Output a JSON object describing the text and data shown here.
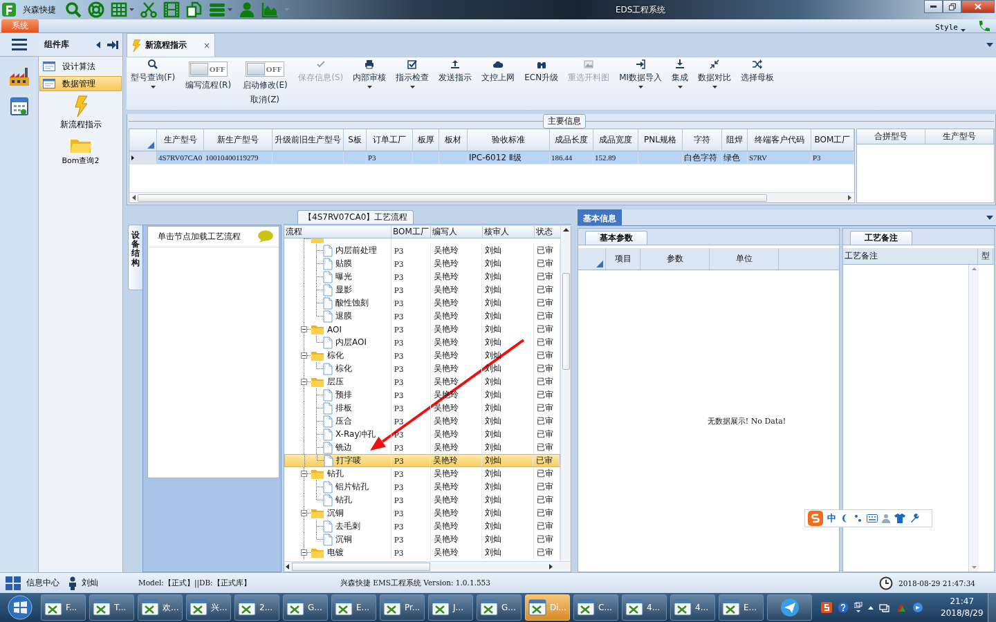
{
  "window": {
    "app_name": "兴森快捷",
    "title": "EDS工程系统"
  },
  "ribbon": {
    "tabs": [
      {
        "label": "系统",
        "selected": true
      }
    ],
    "style_menu": "Style"
  },
  "sidebar": {
    "title": "组件库",
    "items": [
      {
        "label": "设计算法",
        "selected": false
      },
      {
        "label": "数据管理",
        "selected": true
      }
    ],
    "tools": [
      {
        "label": "新流程指示"
      },
      {
        "label": "Bom查询2"
      }
    ]
  },
  "document_tabs": [
    {
      "label": "新流程指示",
      "selected": true,
      "close_glyph": "×"
    }
  ],
  "toolbar": [
    {
      "kind": "button",
      "label": "型号查询(F)",
      "disabled": false,
      "dropdown": true
    },
    {
      "kind": "toggle",
      "label": "编写流程(R)",
      "on": false,
      "state_text": "OFF"
    },
    {
      "kind": "toggle",
      "label": "启动修改(E)",
      "sublabel": "取消(Z)",
      "on": false,
      "state_text": "OFF"
    },
    {
      "kind": "button",
      "label": "保存信息(S)",
      "disabled": true,
      "dropdown": false
    },
    {
      "kind": "button",
      "label": "内部审核",
      "disabled": false,
      "dropdown": true
    },
    {
      "kind": "button",
      "label": "指示检查",
      "disabled": false,
      "dropdown": true
    },
    {
      "kind": "button",
      "label": "发送指示",
      "disabled": false,
      "dropdown": false
    },
    {
      "kind": "button",
      "label": "文控上网",
      "disabled": false,
      "dropdown": false
    },
    {
      "kind": "button",
      "label": "ECN升级",
      "disabled": false,
      "dropdown": false
    },
    {
      "kind": "button",
      "label": "重选开料图",
      "disabled": true,
      "dropdown": false
    },
    {
      "kind": "button",
      "label": "MI数据导入",
      "disabled": false,
      "dropdown": true
    },
    {
      "kind": "button",
      "label": "集成",
      "disabled": false,
      "dropdown": true
    },
    {
      "kind": "button",
      "label": "数据对比",
      "disabled": false,
      "dropdown": true
    },
    {
      "kind": "button",
      "label": "选择母板",
      "disabled": false,
      "dropdown": false
    }
  ],
  "main_info": {
    "title": "主要信息",
    "columns": [
      "生产型号",
      "新生产型号",
      "升级前旧生产型号",
      "S板",
      "订单工厂",
      "板厚",
      "板材",
      "验收标准",
      "成品长度",
      "成品宽度",
      "PNL规格",
      "字符",
      "阻焊",
      "终端客户代码",
      "BOM工厂"
    ],
    "rows": [
      {
        "selected": true,
        "cells": [
          "4S7RV07CA0",
          "10010400119279",
          null,
          null,
          "P3",
          null,
          null,
          "IPC-6012 Ⅱ级",
          "186.44",
          "152.89",
          null,
          "白色字符",
          "绿色",
          "S7RV",
          "P3"
        ]
      }
    ],
    "side_columns": [
      "合拼型号",
      "生产型号"
    ]
  },
  "process": {
    "side_tab": "设备结构",
    "hint": "单击节点加载工艺流程",
    "title": "【4S7RV07CA0】工艺流程",
    "columns": [
      "流程",
      "BOM工厂",
      "编写人",
      "核审人",
      "状态"
    ],
    "tree": [
      {
        "kind": "folder",
        "selected": false,
        "children": [
          {
            "kind": "file",
            "label": "内层前处理",
            "bom": "P3",
            "author": "吴艳玲",
            "reviewer": "刘灿",
            "status": "已审",
            "selected": false
          },
          {
            "kind": "file",
            "label": "贴膜",
            "bom": "P3",
            "author": "吴艳玲",
            "reviewer": "刘灿",
            "status": "已审",
            "selected": false
          },
          {
            "kind": "file",
            "label": "曝光",
            "bom": "P3",
            "author": "吴艳玲",
            "reviewer": "刘灿",
            "status": "已审",
            "selected": false
          },
          {
            "kind": "file",
            "label": "显影",
            "bom": "P3",
            "author": "吴艳玲",
            "reviewer": "刘灿",
            "status": "已审",
            "selected": false
          },
          {
            "kind": "file",
            "label": "酸性蚀刻",
            "bom": "P3",
            "author": "吴艳玲",
            "reviewer": "刘灿",
            "status": "已审",
            "selected": false
          },
          {
            "kind": "file",
            "label": "退膜",
            "bom": "P3",
            "author": "吴艳玲",
            "reviewer": "刘灿",
            "status": "已审",
            "selected": false
          }
        ]
      },
      {
        "kind": "folder",
        "label": "AOI",
        "bom": "P3",
        "author": "吴艳玲",
        "reviewer": "刘灿",
        "status": "已审",
        "expanded": true,
        "selected": false,
        "children": [
          {
            "kind": "file",
            "label": "内层AOI",
            "bom": "P3",
            "author": "吴艳玲",
            "reviewer": "刘灿",
            "status": "已审",
            "selected": false
          }
        ]
      },
      {
        "kind": "folder",
        "label": "棕化",
        "bom": "P3",
        "author": "吴艳玲",
        "reviewer": "刘灿",
        "status": "已审",
        "expanded": true,
        "selected": false,
        "children": [
          {
            "kind": "file",
            "label": "棕化",
            "bom": "P3",
            "author": "吴艳玲",
            "reviewer": "刘灿",
            "status": "已审",
            "selected": false
          }
        ]
      },
      {
        "kind": "folder",
        "label": "层压",
        "bom": "P3",
        "author": "吴艳玲",
        "reviewer": "刘灿",
        "status": "已审",
        "expanded": true,
        "selected": false,
        "children": [
          {
            "kind": "file",
            "label": "预排",
            "bom": "P3",
            "author": "吴艳玲",
            "reviewer": "刘灿",
            "status": "已审",
            "selected": false
          },
          {
            "kind": "file",
            "label": "排板",
            "bom": "P3",
            "author": "吴艳玲",
            "reviewer": "刘灿",
            "status": "已审",
            "selected": false
          },
          {
            "kind": "file",
            "label": "压合",
            "bom": "P3",
            "author": "吴艳玲",
            "reviewer": "刘灿",
            "status": "已审",
            "selected": false
          },
          {
            "kind": "file",
            "label": "X-Ray冲孔",
            "bom": "P3",
            "author": "吴艳玲",
            "reviewer": "刘灿",
            "status": "已审",
            "selected": false
          },
          {
            "kind": "file",
            "label": "铣边",
            "bom": "P3",
            "author": "吴艳玲",
            "reviewer": "刘灿",
            "status": "已审",
            "selected": false
          },
          {
            "kind": "file",
            "label": "打字唛",
            "bom": "P3",
            "author": "吴艳玲",
            "reviewer": "刘灿",
            "status": "已审",
            "selected": true
          }
        ]
      },
      {
        "kind": "folder",
        "label": "钻孔",
        "bom": "P3",
        "author": "吴艳玲",
        "reviewer": "刘灿",
        "status": "已审",
        "expanded": true,
        "selected": false,
        "children": [
          {
            "kind": "file",
            "label": "铝片钻孔",
            "bom": "P3",
            "author": "吴艳玲",
            "reviewer": "刘灿",
            "status": "已审",
            "selected": false
          },
          {
            "kind": "file",
            "label": "钻孔",
            "bom": "P3",
            "author": "吴艳玲",
            "reviewer": "刘灿",
            "status": "已审",
            "selected": false
          }
        ]
      },
      {
        "kind": "folder",
        "label": "沉铜",
        "bom": "P3",
        "author": "吴艳玲",
        "reviewer": "刘灿",
        "status": "已审",
        "expanded": true,
        "selected": false,
        "children": [
          {
            "kind": "file",
            "label": "去毛刺",
            "bom": "P3",
            "author": "吴艳玲",
            "reviewer": "刘灿",
            "status": "已审",
            "selected": false
          },
          {
            "kind": "file",
            "label": "沉铜",
            "bom": "P3",
            "author": "吴艳玲",
            "reviewer": "刘灿",
            "status": "已审",
            "selected": false
          }
        ]
      },
      {
        "kind": "folder",
        "label": "电镀",
        "bom": "P3",
        "author": "吴艳玲",
        "reviewer": "刘灿",
        "status": "已审",
        "expanded": true,
        "selected": false
      }
    ]
  },
  "basic_info": {
    "tab": "基本信息",
    "subtab": "基本参数",
    "columns": [
      "项目",
      "参数",
      "单位"
    ],
    "empty_text": "无数据展示! No Data!"
  },
  "remarks": {
    "tab": "工艺备注",
    "columns": [
      "工艺备注",
      "型"
    ]
  },
  "ime": {
    "mode": "中"
  },
  "status_bar": {
    "info": "信息中心",
    "user": "刘灿",
    "model": "Model:【正式】||DB:【正式库】",
    "product": "兴森快捷 EMS工程系统 Version: 1.0.1.553",
    "datetime": "2018-08-29 21:47:34"
  },
  "taskbar": {
    "items": [
      {
        "label": "F...",
        "selected": false
      },
      {
        "label": "T...",
        "selected": false
      },
      {
        "label": "欢...",
        "selected": false
      },
      {
        "label": "兴...",
        "selected": false
      },
      {
        "label": "2...",
        "selected": false
      },
      {
        "label": "G...",
        "selected": false
      },
      {
        "label": "E...",
        "selected": false
      },
      {
        "label": "Pr...",
        "selected": false
      },
      {
        "label": "J...",
        "selected": false
      },
      {
        "label": "G...",
        "selected": false
      },
      {
        "label": "Di...",
        "selected": true
      },
      {
        "label": "C...",
        "selected": false
      },
      {
        "label": "4...",
        "selected": false
      },
      {
        "label": "4...",
        "selected": false
      },
      {
        "label": "E...",
        "selected": false
      }
    ],
    "time": "21:47",
    "date": "2018/8/29"
  }
}
